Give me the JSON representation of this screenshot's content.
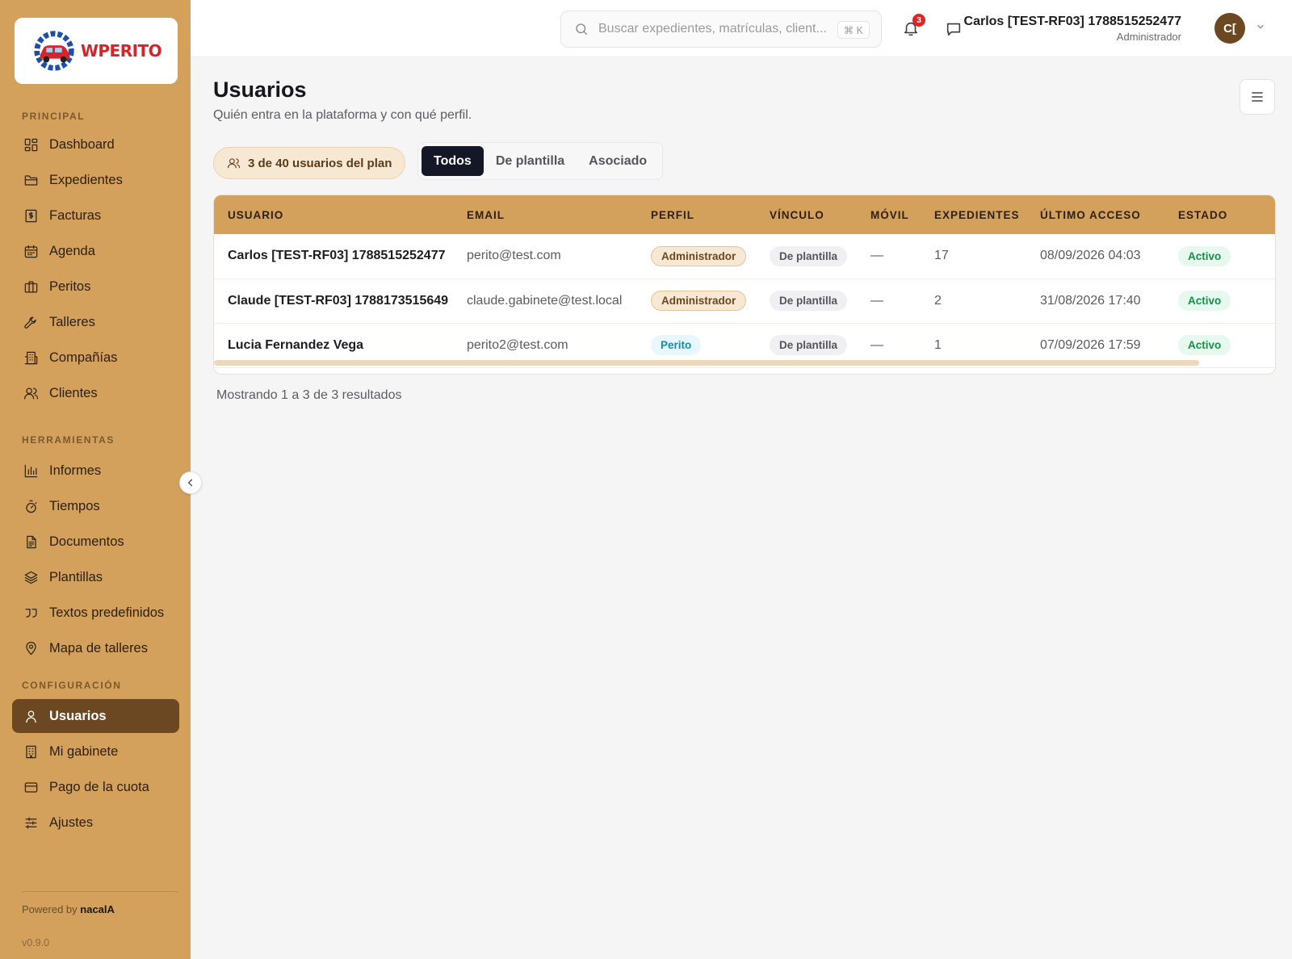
{
  "brand": {
    "logo_text": "WPERITO"
  },
  "sidebar": {
    "sections": [
      {
        "label": "PRINCIPAL"
      },
      {
        "label": "HERRAMIENTAS"
      },
      {
        "label": "CONFIGURACIÓN"
      }
    ],
    "items": [
      {
        "label": "Dashboard",
        "icon": "dashboard-icon"
      },
      {
        "label": "Expedientes",
        "icon": "folder-icon"
      },
      {
        "label": "Facturas",
        "icon": "invoice-icon"
      },
      {
        "label": "Agenda",
        "icon": "calendar-icon"
      },
      {
        "label": "Peritos",
        "icon": "briefcase-icon"
      },
      {
        "label": "Talleres",
        "icon": "wrench-icon"
      },
      {
        "label": "Compañías",
        "icon": "building-icon"
      },
      {
        "label": "Clientes",
        "icon": "users-icon"
      },
      {
        "label": "Informes",
        "icon": "bar-chart-icon"
      },
      {
        "label": "Tiempos",
        "icon": "timer-icon"
      },
      {
        "label": "Documentos",
        "icon": "document-icon"
      },
      {
        "label": "Plantillas",
        "icon": "layers-icon"
      },
      {
        "label": "Textos predefinidos",
        "icon": "quote-icon"
      },
      {
        "label": "Mapa de talleres",
        "icon": "map-pin-icon"
      },
      {
        "label": "Usuarios",
        "icon": "user-icon",
        "active": true
      },
      {
        "label": "Mi gabinete",
        "icon": "office-icon"
      },
      {
        "label": "Pago de la cuota",
        "icon": "credit-card-icon"
      },
      {
        "label": "Ajustes",
        "icon": "sliders-icon"
      }
    ],
    "powered_prefix": "Powered by",
    "powered_brand": "nacalA",
    "version": "v0.9.0"
  },
  "topbar": {
    "search_placeholder": "Buscar expedientes, matrículas, client...",
    "search_shortcut": "⌘ K",
    "notifications_count": "3",
    "user_name": "Carlos [TEST-RF03] 1788515252477",
    "user_role": "Administrador",
    "avatar_initials": "C["
  },
  "page": {
    "title": "Usuarios",
    "subtitle": "Quién entra en la plataforma y con qué perfil.",
    "plan_usage": "3 de 40 usuarios del plan",
    "filters": [
      "Todos",
      "De plantilla",
      "Asociado"
    ],
    "active_filter": "Todos",
    "results_text": "Mostrando 1 a 3 de 3 resultados"
  },
  "table": {
    "columns": [
      "USUARIO",
      "EMAIL",
      "PERFIL",
      "VÍNCULO",
      "MÓVIL",
      "EXPEDIENTES",
      "ÚLTIMO ACCESO",
      "ESTADO"
    ],
    "rows": [
      {
        "usuario": "Carlos [TEST-RF03] 1788515252477",
        "email": "perito@test.com",
        "perfil": "Administrador",
        "vinculo": "De plantilla",
        "movil": "—",
        "expedientes": "17",
        "ultimo_acceso": "08/09/2026 04:03",
        "estado": "Activo"
      },
      {
        "usuario": "Claude [TEST-RF03] 1788173515649",
        "email": "claude.gabinete@test.local",
        "perfil": "Administrador",
        "vinculo": "De plantilla",
        "movil": "—",
        "expedientes": "2",
        "ultimo_acceso": "31/08/2026 17:40",
        "estado": "Activo"
      },
      {
        "usuario": "Lucia Fernandez Vega",
        "email": "perito2@test.com",
        "perfil": "Perito",
        "vinculo": "De plantilla",
        "movil": "—",
        "expedientes": "1",
        "ultimo_acceso": "07/09/2026 17:59",
        "estado": "Activo"
      }
    ]
  },
  "colors": {
    "sidebar_bg": "#d4a15c",
    "active_item_bg": "#6b4722",
    "accent_dark": "#141826",
    "status_active": "#15914a",
    "badge_red": "#dc2626"
  }
}
